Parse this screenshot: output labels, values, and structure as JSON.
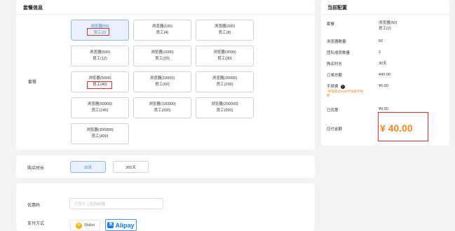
{
  "package_info": {
    "title": "套餐信息",
    "row_label": "套餐",
    "packages": [
      {
        "line1": "浏览器(50)",
        "line2": "员工(2)",
        "selected": true
      },
      {
        "line1": "浏览器(100)",
        "line2": "员工(4)",
        "selected": false
      },
      {
        "line1": "浏览器(200)",
        "line2": "员工(8)",
        "selected": false
      },
      {
        "line1": "浏览器(500)",
        "line2": "员工(12)",
        "selected": false
      },
      {
        "line1": "浏览器(1000)",
        "line2": "员工(20)",
        "selected": false
      },
      {
        "line1": "浏览器(3000)",
        "line2": "员工(30)",
        "selected": false
      },
      {
        "line1": "浏览器(5000)",
        "line2": "员工(40)",
        "selected": false
      },
      {
        "line1": "浏览器(10000)",
        "line2": "员工(60)",
        "selected": false
      },
      {
        "line1": "浏览器(20000)",
        "line2": "员工(100)",
        "selected": false
      },
      {
        "line1": "浏览器(50000)",
        "line2": "员工(140)",
        "selected": false
      },
      {
        "line1": "浏览器(100000)",
        "line2": "员工(200)",
        "selected": false
      },
      {
        "line1": "浏览器(200000)",
        "line2": "员工(300)",
        "selected": false
      },
      {
        "line1": "浏览器(300000)",
        "line2": "员工(400)",
        "selected": false
      }
    ]
  },
  "duration": {
    "label": "购买时长",
    "options": [
      {
        "label": "30天",
        "selected": true
      },
      {
        "label": "365天",
        "selected": false
      }
    ]
  },
  "coupon": {
    "label": "优惠码",
    "placeholder": "六至十二位码必填"
  },
  "payment": {
    "label": "支付方式",
    "wallet_label": "Wallet",
    "alipay_label": "Alipay"
  },
  "current_config": {
    "title": "当前配置",
    "package_label": "套餐",
    "package_line1": "浏览器(50)",
    "package_line2": "员工(2)",
    "browser_count_label": "浏览器数量",
    "browser_count": "50",
    "team_count_label": "团队成员数量",
    "team_count": "2",
    "duration_label": "购买时长",
    "duration": "30天",
    "order_total_label": "订单总额",
    "order_total": "¥40.00",
    "fee_label": "手续费",
    "fee": "¥0.00",
    "fee_note_1": "*单笔超过¥100不收取手续",
    "fee_note_2": "费",
    "discount_label": "已优惠",
    "discount": "¥0.00",
    "payable_label": "应付金额",
    "payable": "¥ 40.00"
  },
  "colors": {
    "accent": "#4a7fcf",
    "highlight": "#e0302a",
    "price": "#f08a1c",
    "alipay": "#1677ff"
  }
}
